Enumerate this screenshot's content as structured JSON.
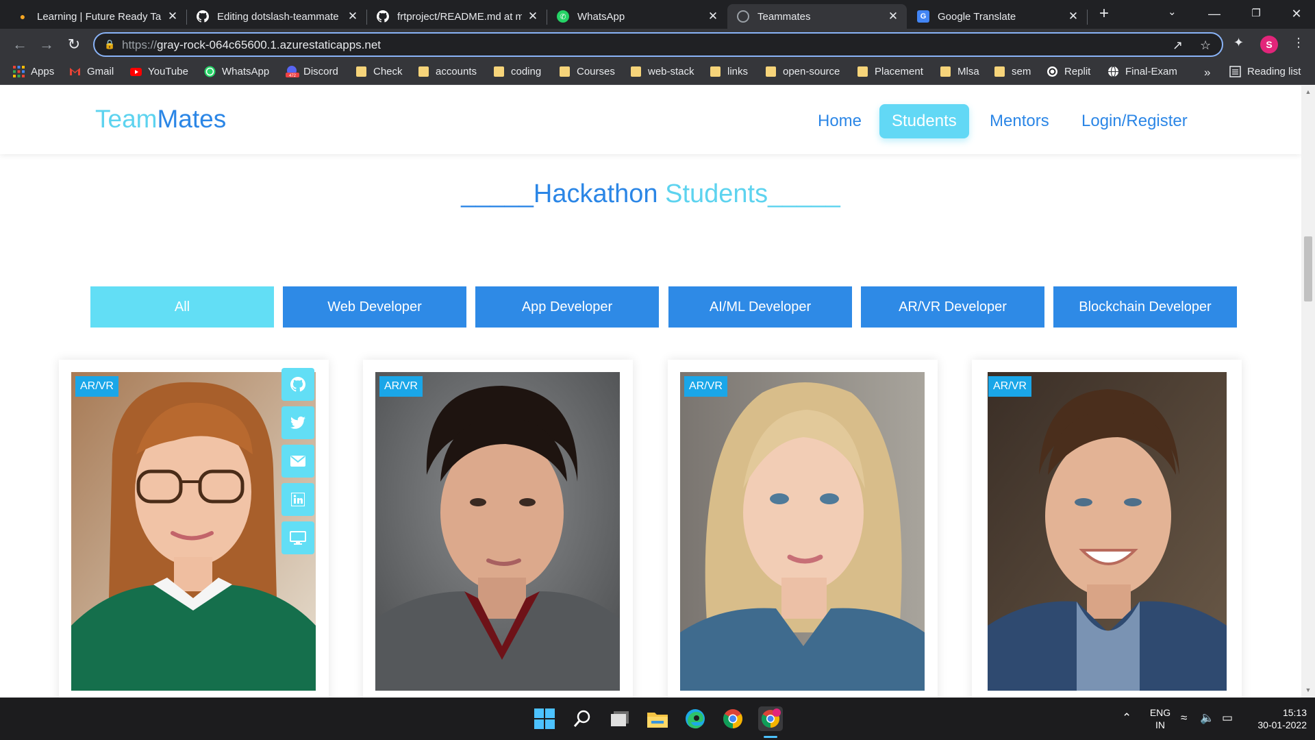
{
  "browser": {
    "tabs": [
      {
        "title": "Learning | Future Ready Tal",
        "icon": "sunbird-icon",
        "color": "#f5a623"
      },
      {
        "title": "Editing dotslash-teammate",
        "icon": "github-icon",
        "color": "#ffffff"
      },
      {
        "title": "frtproject/README.md at m",
        "icon": "github-icon",
        "color": "#ffffff"
      },
      {
        "title": "WhatsApp",
        "icon": "whatsapp-icon",
        "color": "#25d366"
      },
      {
        "title": "Teammates",
        "icon": "globe-icon",
        "color": "#9aa0a6"
      },
      {
        "title": "Google Translate",
        "icon": "google-translate-icon",
        "color": "#4285f4"
      }
    ],
    "url_scheme": "https://",
    "url_host": "gray-rock-064c65600.1.azurestaticapps.net",
    "profile_initial": "S",
    "bookmarks": [
      {
        "label": "Apps",
        "icon": "apps-grid-icon"
      },
      {
        "label": "Gmail",
        "icon": "gmail-icon"
      },
      {
        "label": "YouTube",
        "icon": "youtube-icon"
      },
      {
        "label": "WhatsApp",
        "icon": "whatsapp-icon"
      },
      {
        "label": "Discord",
        "icon": "discord-icon"
      },
      {
        "label": "Check",
        "icon": "folder-icon"
      },
      {
        "label": "accounts",
        "icon": "folder-icon"
      },
      {
        "label": "coding",
        "icon": "folder-icon"
      },
      {
        "label": "Courses",
        "icon": "folder-icon"
      },
      {
        "label": "web-stack",
        "icon": "folder-icon"
      },
      {
        "label": "links",
        "icon": "folder-icon"
      },
      {
        "label": "open-source",
        "icon": "folder-icon"
      },
      {
        "label": "Placement",
        "icon": "folder-icon"
      },
      {
        "label": "Mlsa",
        "icon": "folder-icon"
      },
      {
        "label": "sem",
        "icon": "folder-icon"
      },
      {
        "label": "Replit",
        "icon": "replit-icon"
      },
      {
        "label": "Final-Exam",
        "icon": "globe-icon"
      }
    ],
    "overflow_label": "»",
    "reading_list": "Reading list",
    "discord_badge": "472"
  },
  "site": {
    "logo_part1": "Team",
    "logo_part2": "Mates",
    "nav": [
      {
        "label": "Home",
        "active": false
      },
      {
        "label": "Students",
        "active": true
      },
      {
        "label": "Mentors",
        "active": false
      },
      {
        "label": "Login/Register",
        "active": false
      }
    ],
    "section_title_part1": "_____Hackathon ",
    "section_title_part2": "Students_____",
    "filters": [
      {
        "label": "All",
        "active": true
      },
      {
        "label": "Web Developer",
        "active": false
      },
      {
        "label": "App Developer",
        "active": false
      },
      {
        "label": "AI/ML Developer",
        "active": false
      },
      {
        "label": "AR/VR Developer",
        "active": false
      },
      {
        "label": "Blockchain Developer",
        "active": false
      }
    ],
    "cards": [
      {
        "badge": "AR/VR",
        "social_icons": [
          "github-icon",
          "twitter-icon",
          "email-icon",
          "linkedin-icon",
          "portfolio-monitor-icon"
        ]
      },
      {
        "badge": "AR/VR"
      },
      {
        "badge": "AR/VR"
      },
      {
        "badge": "AR/VR"
      }
    ]
  },
  "taskbar": {
    "apps": [
      "windows-start-icon",
      "search-icon",
      "task-view-icon",
      "file-explorer-icon",
      "edge-icon",
      "chrome-icon",
      "chrome-profile-icon"
    ],
    "lang_top": "ENG",
    "lang_bottom": "IN",
    "time": "15:13",
    "date": "30-01-2022"
  },
  "colors": {
    "primary": "#2e8ae6",
    "accent": "#62def5",
    "badge": "#1aa6e8"
  }
}
